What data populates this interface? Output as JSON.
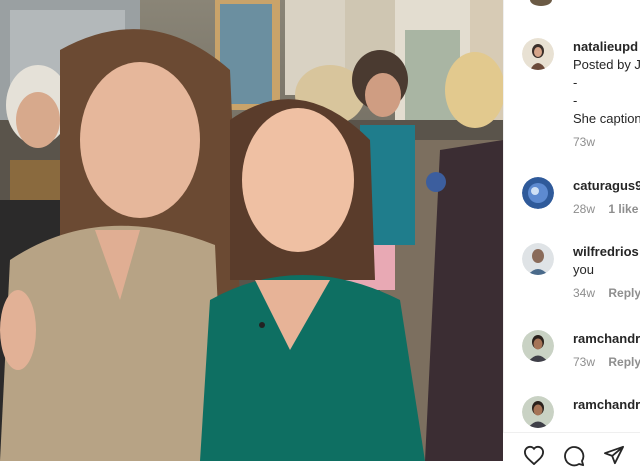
{
  "comments": [
    {
      "username": "natalieupd",
      "lines": [
        "Posted by J",
        "-",
        "-",
        "She caption"
      ],
      "time": "73w",
      "likes": "",
      "reply": ""
    },
    {
      "username": "caturagus9",
      "lines": [],
      "time": "28w",
      "likes": "1 like",
      "reply": ""
    },
    {
      "username": "wilfredrios",
      "lines": [
        "you"
      ],
      "time": "34w",
      "likes": "",
      "reply": "Reply"
    },
    {
      "username": "ramchandr",
      "lines": [],
      "time": "73w",
      "likes": "",
      "reply": "Reply"
    },
    {
      "username": "ramchandr",
      "lines": [],
      "time": "",
      "likes": "",
      "reply": ""
    }
  ],
  "icons": [
    "heart-icon",
    "comment-icon",
    "share-icon"
  ],
  "colors": {
    "text": "#262626",
    "meta": "#8e8e8e",
    "divider": "#efefef"
  }
}
